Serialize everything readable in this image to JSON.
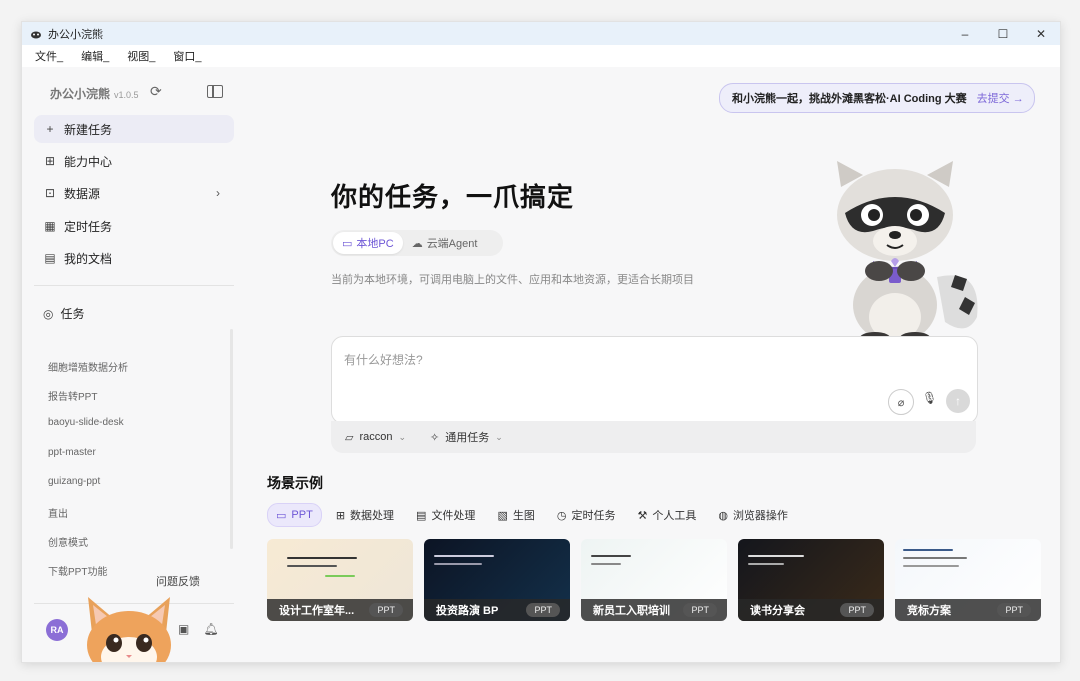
{
  "window": {
    "title": "办公小浣熊",
    "minimize": "–",
    "maximize": "☐",
    "close": "✕"
  },
  "menu": [
    "文件_",
    "编辑_",
    "视图_",
    "窗口_"
  ],
  "sidebar": {
    "brand": "办公小浣熊",
    "version": "v1.0.5",
    "nav": [
      {
        "label": "新建任务",
        "icon": "plus-icon"
      },
      {
        "label": "能力中心",
        "icon": "apps-icon"
      },
      {
        "label": "数据源",
        "icon": "database-icon"
      },
      {
        "label": "定时任务",
        "icon": "calendar-icon"
      },
      {
        "label": "我的文档",
        "icon": "document-icon"
      }
    ],
    "task_header": "任务",
    "tasks": [
      "细胞增殖数据分析",
      "报告转PPT",
      "baoyu-slide-desk",
      "ppt-master",
      "guizang-ppt",
      "直出",
      "创意模式",
      "下载PPT功能"
    ],
    "feedback": "问题反馈",
    "avatar": "RA"
  },
  "main": {
    "banner_text": "和小浣熊一起，挑战外滩黑客松·AI Coding 大赛",
    "banner_link": "去提交 →",
    "hero_title": "你的任务，一爪搞定",
    "modes": [
      "本地PC",
      "云端Agent"
    ],
    "mode_desc": "当前为本地环境，可调用电脑上的文件、应用和本地资源，更适合长期项目",
    "input_placeholder": "有什么好想法?",
    "agent_select": "raccon",
    "task_type_select": "通用任务",
    "section_title": "场景示例",
    "tabs": [
      {
        "label": "PPT",
        "icon": "slides-icon"
      },
      {
        "label": "数据处理",
        "icon": "table-icon"
      },
      {
        "label": "文件处理",
        "icon": "file-icon"
      },
      {
        "label": "生图",
        "icon": "image-icon"
      },
      {
        "label": "定时任务",
        "icon": "clock-icon"
      },
      {
        "label": "个人工具",
        "icon": "wrench-icon"
      },
      {
        "label": "浏览器操作",
        "icon": "globe-icon"
      }
    ],
    "cards": [
      {
        "title": "设计工作室年...",
        "badge": "PPT"
      },
      {
        "title": "投资路演 BP",
        "badge": "PPT"
      },
      {
        "title": "新员工入职培训",
        "badge": "PPT"
      },
      {
        "title": "读书分享会",
        "badge": "PPT"
      },
      {
        "title": "竞标方案",
        "badge": "PPT"
      }
    ]
  }
}
